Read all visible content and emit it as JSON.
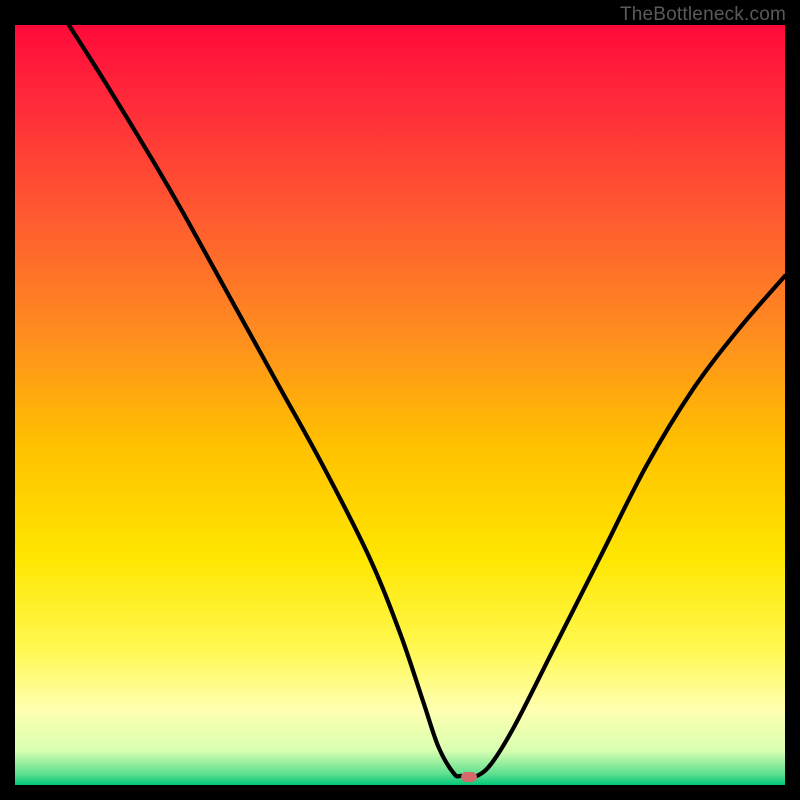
{
  "watermark": "TheBottleneck.com",
  "chart_data": {
    "type": "line",
    "title": "",
    "xlabel": "",
    "ylabel": "",
    "xlim": [
      0,
      100
    ],
    "ylim": [
      0,
      100
    ],
    "series": [
      {
        "name": "bottleneck-curve",
        "x": [
          7,
          12,
          18,
          22,
          28,
          34,
          40,
          46,
          50,
          53,
          55,
          57,
          58,
          60,
          62,
          65,
          70,
          76,
          82,
          88,
          94,
          100
        ],
        "y": [
          100,
          92,
          82,
          75,
          64,
          53,
          42,
          30,
          20,
          11,
          5,
          1.5,
          1.2,
          1.2,
          3,
          8,
          18,
          30,
          42,
          52,
          60,
          67
        ]
      }
    ],
    "marker": {
      "x": 59,
      "y": 1.0,
      "color": "#d46a6a"
    },
    "gradient_stops": [
      {
        "offset": 0.0,
        "color": "#ff0a3a"
      },
      {
        "offset": 0.1,
        "color": "#ff2a3a"
      },
      {
        "offset": 0.25,
        "color": "#ff5a30"
      },
      {
        "offset": 0.4,
        "color": "#ff8a20"
      },
      {
        "offset": 0.55,
        "color": "#ffc000"
      },
      {
        "offset": 0.7,
        "color": "#ffe600"
      },
      {
        "offset": 0.82,
        "color": "#fff850"
      },
      {
        "offset": 0.9,
        "color": "#ffffb0"
      },
      {
        "offset": 0.955,
        "color": "#d8ffb0"
      },
      {
        "offset": 0.985,
        "color": "#60e090"
      },
      {
        "offset": 1.0,
        "color": "#00c878"
      }
    ]
  }
}
